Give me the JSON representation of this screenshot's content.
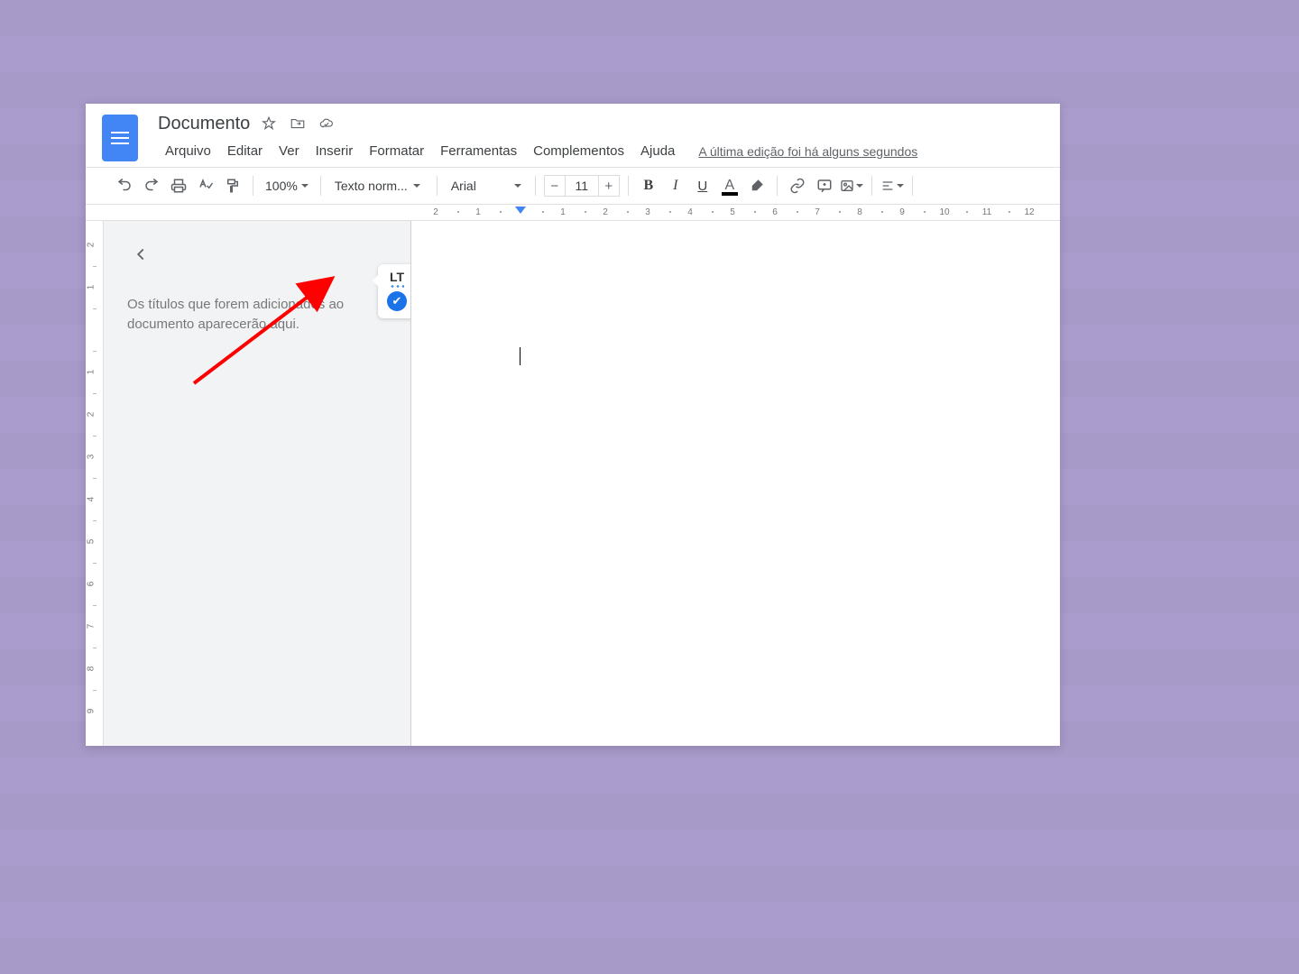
{
  "header": {
    "title": "Documento",
    "menu": [
      "Arquivo",
      "Editar",
      "Ver",
      "Inserir",
      "Formatar",
      "Ferramentas",
      "Complementos",
      "Ajuda"
    ],
    "last_edit": "A última edição foi há alguns segundos"
  },
  "toolbar": {
    "zoom": "100%",
    "style": "Texto norm...",
    "font": "Arial",
    "font_size": "11",
    "minus": "−",
    "plus": "+"
  },
  "outline": {
    "placeholder": "Os títulos que forem adicionados ao documento aparecerão aqui."
  },
  "ruler_h": [
    2,
    1,
    1,
    2,
    3,
    4,
    5,
    6,
    7,
    8,
    9,
    10,
    11,
    12
  ],
  "ruler_v_neg": [
    2,
    1
  ],
  "ruler_v_pos": [
    1,
    2,
    3,
    4,
    5,
    6,
    7,
    8,
    9
  ],
  "lt": {
    "label": "LT",
    "check": "✔"
  }
}
